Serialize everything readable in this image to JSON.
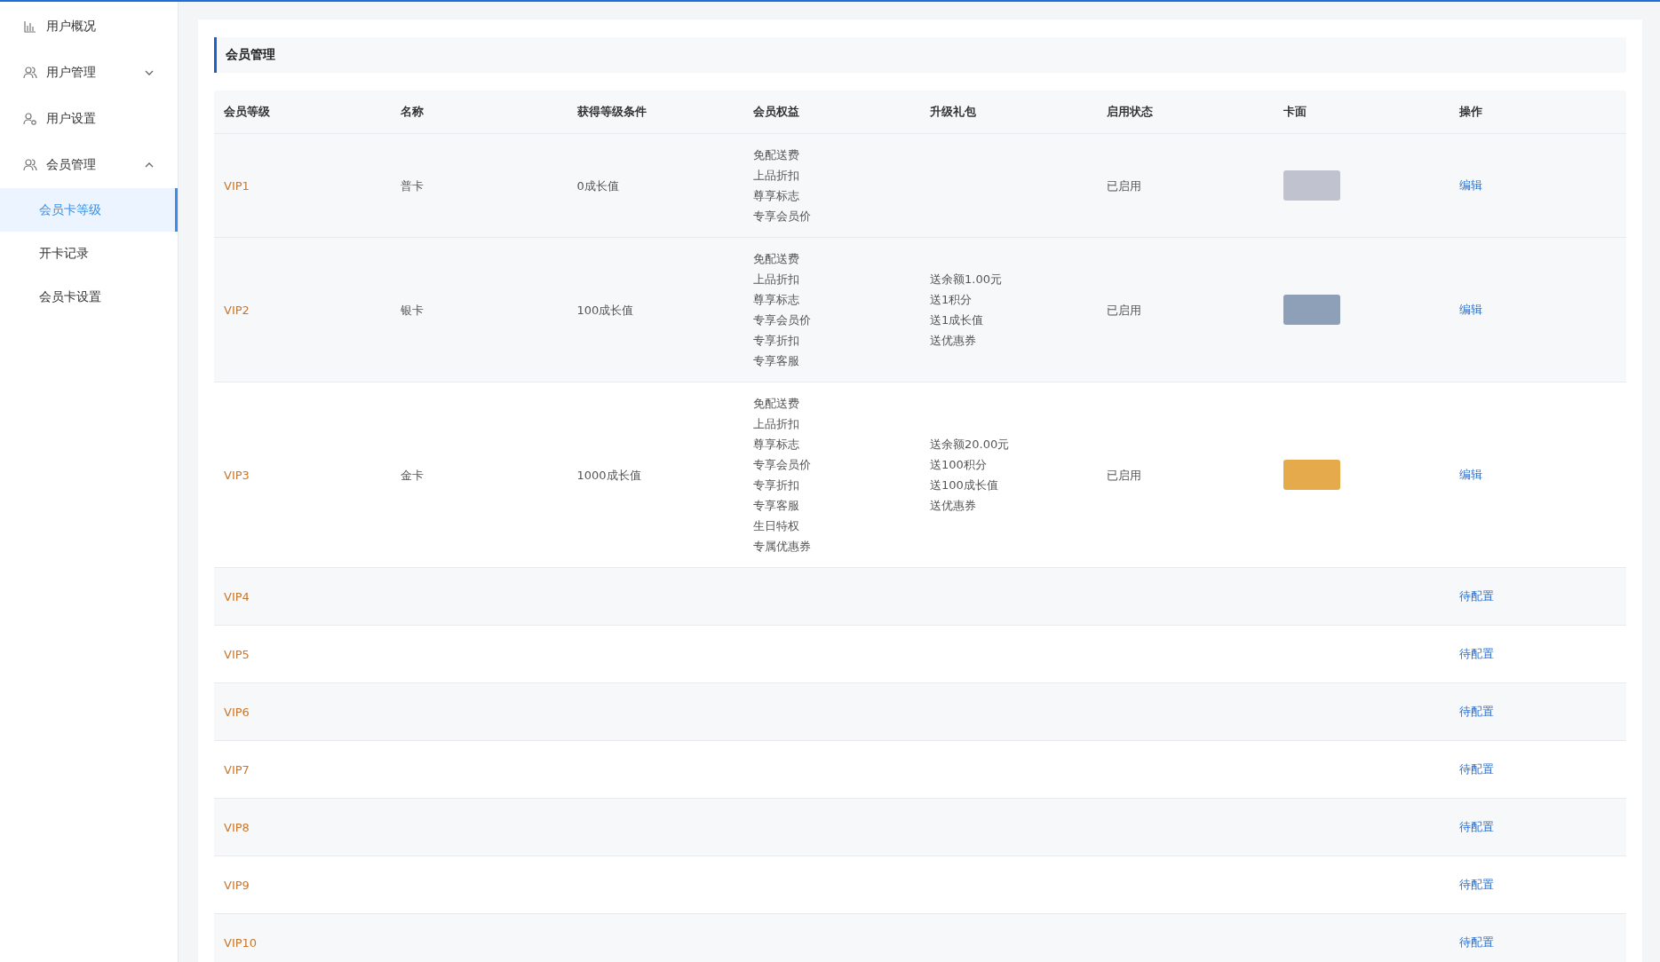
{
  "sidebar": {
    "items": [
      {
        "label": "用户概况"
      },
      {
        "label": "用户管理",
        "expanded": false
      },
      {
        "label": "用户设置"
      },
      {
        "label": "会员管理",
        "expanded": true,
        "children": [
          {
            "label": "会员卡等级",
            "selected": true
          },
          {
            "label": "开卡记录",
            "selected": false
          },
          {
            "label": "会员卡设置",
            "selected": false
          }
        ]
      }
    ]
  },
  "panel": {
    "title": "会员管理"
  },
  "table": {
    "columns": [
      "会员等级",
      "名称",
      "获得等级条件",
      "会员权益",
      "升级礼包",
      "启用状态",
      "卡面",
      "操作"
    ],
    "rows": [
      {
        "level": "VIP1",
        "name": "普卡",
        "condition": "0成长值",
        "benefits": [
          "免配送费",
          "上品折扣",
          "尊享标志",
          "专享会员价"
        ],
        "status": "已启用",
        "color": "#c0c2d0",
        "action": "编辑"
      },
      {
        "level": "VIP2",
        "name": "银卡",
        "condition": "100成长值",
        "benefits": [
          "免配送费",
          "上品折扣",
          "尊享标志",
          "专享会员价",
          "专享折扣",
          "专享客服"
        ],
        "gifts": [
          "送余额1.00元",
          "送1积分",
          "送1成长值",
          "送优惠券"
        ],
        "status": "已启用",
        "color": "#8da0b8",
        "action": "编辑"
      },
      {
        "level": "VIP3",
        "name": "金卡",
        "condition": "1000成长值",
        "benefits": [
          "免配送费",
          "上品折扣",
          "尊享标志",
          "专享会员价",
          "专享折扣",
          "专享客服",
          "生日特权",
          "专属优惠券"
        ],
        "gifts": [
          "送余额20.00元",
          "送100积分",
          "送100成长值",
          "送优惠券"
        ],
        "status": "已启用",
        "color": "#e4aa4c",
        "action": "编辑"
      },
      {
        "level": "VIP4",
        "action": "待配置"
      },
      {
        "level": "VIP5",
        "action": "待配置"
      },
      {
        "level": "VIP6",
        "action": "待配置"
      },
      {
        "level": "VIP7",
        "action": "待配置"
      },
      {
        "level": "VIP8",
        "action": "待配置"
      },
      {
        "level": "VIP9",
        "action": "待配置"
      },
      {
        "level": "VIP10",
        "action": "待配置"
      }
    ]
  }
}
